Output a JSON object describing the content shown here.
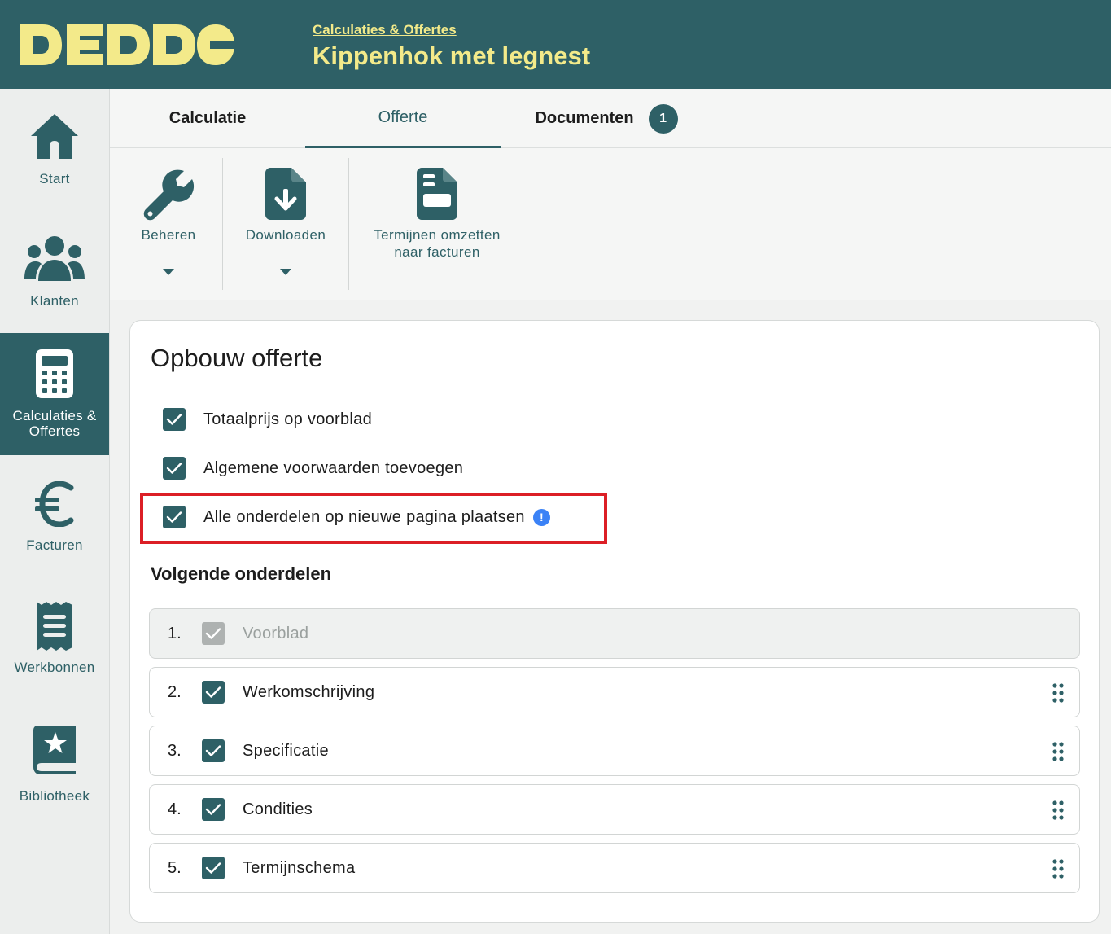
{
  "header": {
    "logo_text": "DEDDO",
    "breadcrumb": "Calculaties & Offertes",
    "title": "Kippenhok met legnest"
  },
  "sidebar": {
    "items": [
      {
        "label": "Start",
        "icon": "home-icon"
      },
      {
        "label": "Klanten",
        "icon": "users-icon"
      },
      {
        "label": "Calculaties & Offertes",
        "icon": "calculator-icon",
        "active": true
      },
      {
        "label": "Facturen",
        "icon": "euro-icon"
      },
      {
        "label": "Werkbonnen",
        "icon": "receipt-icon"
      },
      {
        "label": "Bibliotheek",
        "icon": "book-star-icon"
      }
    ]
  },
  "tabs": [
    {
      "label": "Calculatie"
    },
    {
      "label": "Offerte",
      "active": true
    },
    {
      "label": "Documenten",
      "badge": "1"
    }
  ],
  "toolbar": {
    "beheren": "Beheren",
    "downloaden": "Downloaden",
    "termijnen_line1": "Termijnen omzetten",
    "termijnen_line2": "naar facturen"
  },
  "card": {
    "title": "Opbouw offerte",
    "options": [
      {
        "label": "Totaalprijs op voorblad",
        "checked": true
      },
      {
        "label": "Algemene voorwaarden toevoegen",
        "checked": true
      },
      {
        "label": "Alle onderdelen op nieuwe pagina plaatsen",
        "checked": true,
        "info": "!"
      }
    ],
    "section_title": "Volgende onderdelen",
    "parts": [
      {
        "num": "1.",
        "label": "Voorblad",
        "checked": true,
        "disabled": true
      },
      {
        "num": "2.",
        "label": "Werkomschrijving",
        "checked": true
      },
      {
        "num": "3.",
        "label": "Specificatie",
        "checked": true
      },
      {
        "num": "4.",
        "label": "Condities",
        "checked": true
      },
      {
        "num": "5.",
        "label": "Termijnschema",
        "checked": true
      }
    ]
  },
  "colors": {
    "brand": "#2e6066",
    "accent_yellow": "#f3ea8a",
    "highlight_red": "#dc1f26",
    "info_blue": "#3b82f6"
  }
}
